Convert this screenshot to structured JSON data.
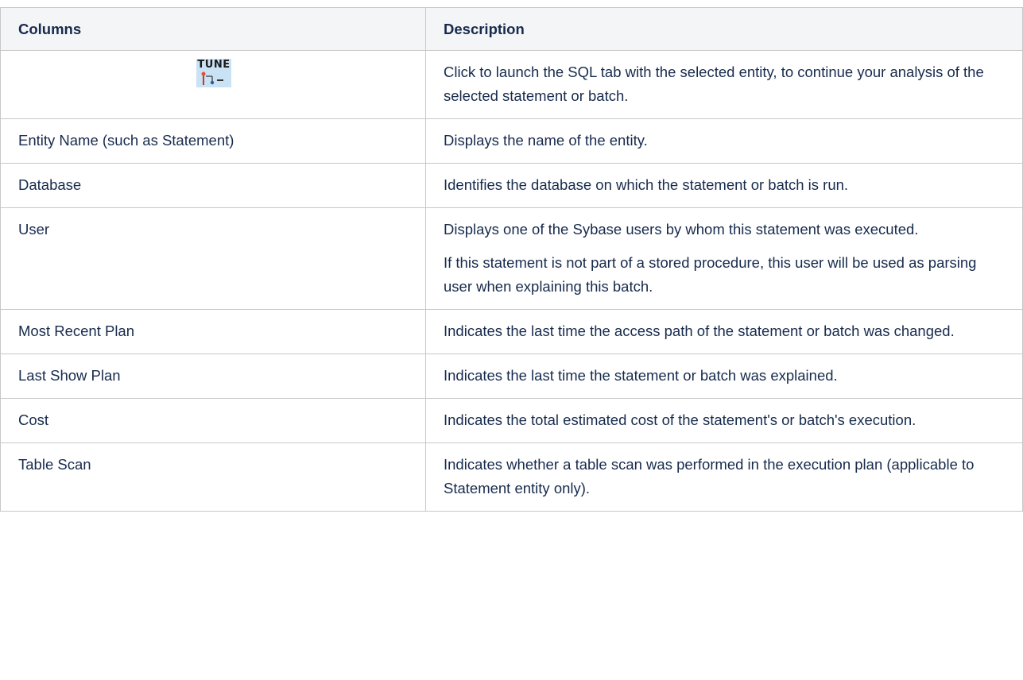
{
  "table": {
    "headers": [
      "Columns",
      "Description"
    ],
    "tune_icon": {
      "icon": "tune-icon",
      "label": "TUNE",
      "description": [
        "Click to launch the SQL tab with the selected entity, to continue your analysis of the selected statement or batch."
      ]
    },
    "rows": [
      {
        "column": "Entity Name (such as Statement)",
        "description": [
          "Displays the name of the entity."
        ]
      },
      {
        "column": "Database",
        "description": [
          "Identifies the database on which the statement or batch is run."
        ]
      },
      {
        "column": "User",
        "description": [
          "Displays one of the Sybase users by whom this statement was executed.",
          "If this statement is not part of a stored procedure, this user will be used as parsing user when explaining this batch."
        ]
      },
      {
        "column": "Most Recent Plan",
        "description": [
          "Indicates the last time the access path of the statement or batch was changed."
        ]
      },
      {
        "column": "Last Show Plan",
        "description": [
          "Indicates the last time the statement or batch was explained."
        ]
      },
      {
        "column": "Cost",
        "description": [
          "Indicates the total estimated cost of the statement's or batch's execution."
        ]
      },
      {
        "column": "Table Scan",
        "description": [
          "Indicates whether a table scan was performed in the execution plan (applicable to Statement entity only)."
        ]
      }
    ]
  }
}
